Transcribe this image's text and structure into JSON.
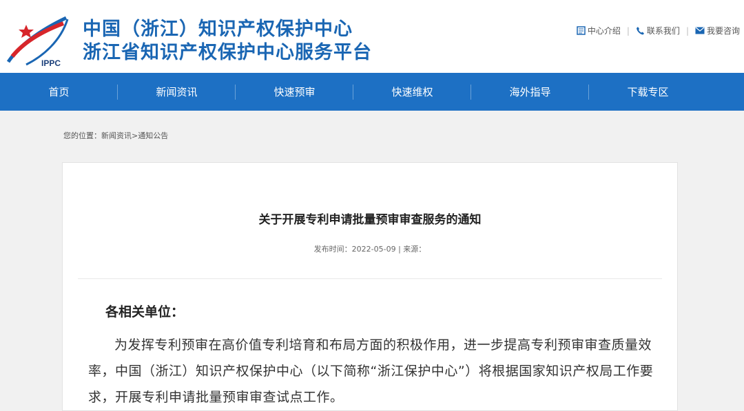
{
  "header": {
    "logo_text": "IPPC",
    "title_line1": "中国（浙江）知识产权保护中心",
    "title_line2": "浙江省知识产权保护中心服务平台",
    "top_links": [
      {
        "label": "中心介绍",
        "icon": "document-icon"
      },
      {
        "label": "联系我们",
        "icon": "phone-icon"
      },
      {
        "label": "我要咨询",
        "icon": "mail-icon"
      }
    ],
    "separator": "|"
  },
  "nav": {
    "items": [
      "首页",
      "新闻资讯",
      "快速预审",
      "快速维权",
      "海外指导",
      "下载专区"
    ]
  },
  "breadcrumb": {
    "prefix": "您的位置：",
    "items": [
      "新闻资讯",
      "通知公告"
    ],
    "separator": ">"
  },
  "article": {
    "title": "关于开展专利申请批量预审审查服务的通知",
    "meta": "发布时间：2022-05-09 | 来源：",
    "salutation": "各相关单位：",
    "paragraph": "为发挥专利预审在高价值专利培育和布局方面的积极作用，进一步提高专利预审审查质量效率，中国（浙江）知识产权保护中心（以下简称“浙江保护中心”）将根据国家知识产权局工作要求，开展专利申请批量预审审查试点工作。"
  },
  "colors": {
    "brand_blue": "#1a66b3",
    "nav_blue": "#1d70c4",
    "logo_red": "#d7262b"
  }
}
